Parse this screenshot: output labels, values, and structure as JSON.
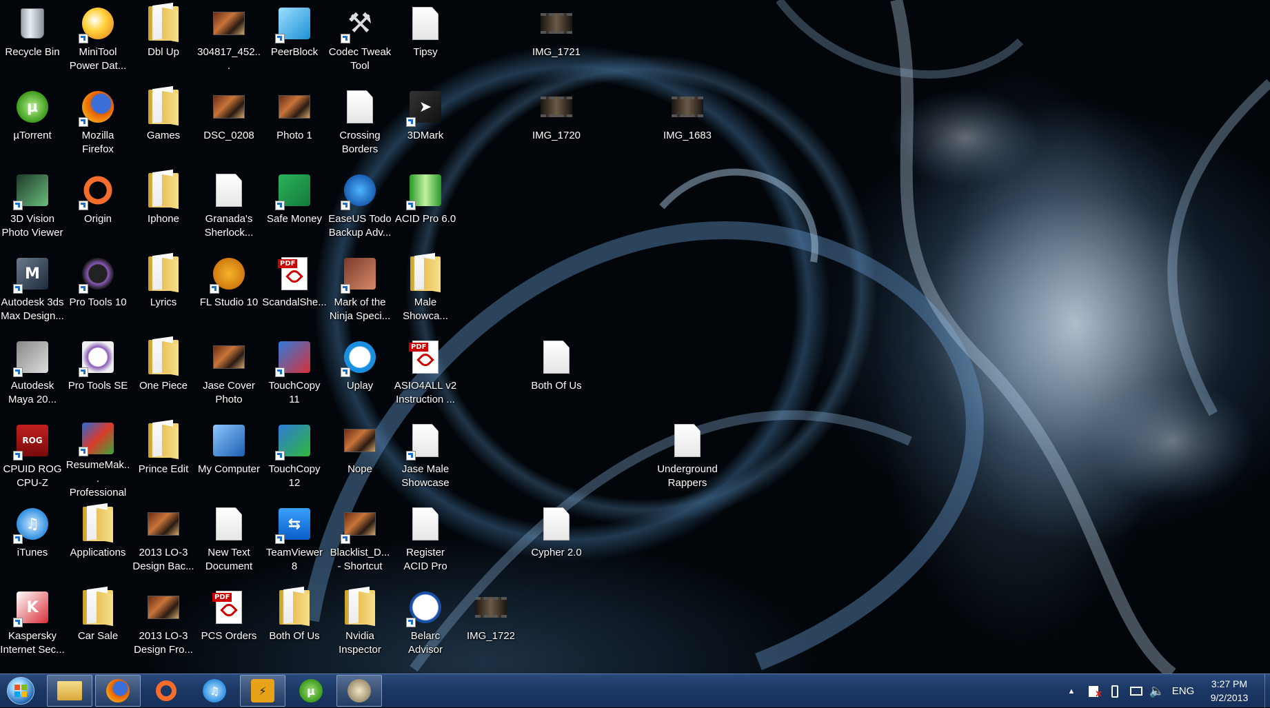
{
  "desktop": {
    "icons": [
      "Recycle Bin",
      "MiniTool\nPower Dat...",
      "Dbl Up",
      "304817_452...",
      "PeerBlock",
      "Codec Tweak\nTool",
      "Tipsy",
      "µTorrent",
      "Mozilla\nFirefox",
      "Games",
      "DSC_0208",
      "Photo 1",
      "Crossing\nBorders",
      "3DMark",
      "3D Vision\nPhoto Viewer",
      "Origin",
      "Iphone",
      "Granada's\nSherlock...",
      "Safe Money",
      "EaseUS Todo\nBackup Adv...",
      "ACID Pro 6.0",
      "Autodesk 3ds\nMax Design...",
      "Pro Tools 10",
      "Lyrics",
      "FL Studio 10",
      "ScandalShe...",
      "Mark of the\nNinja Speci...",
      "Male\nShowca...",
      "Autodesk\nMaya 20...",
      "Pro Tools SE",
      "One Piece",
      "Jase Cover\nPhoto",
      "TouchCopy\n11",
      "Uplay",
      "ASIO4ALL v2\nInstruction ...",
      "CPUID ROG\nCPU-Z",
      "ResumeMak...\nProfessional",
      "Prince Edit",
      "My Computer",
      "TouchCopy\n12",
      "Nope",
      "Jase Male\nShowcase",
      "iTunes",
      "Applications",
      "2013 LO-3\nDesign Bac...",
      "New Text\nDocument",
      "TeamViewer\n8",
      "Blacklist_D...\n- Shortcut",
      "Register\nACID Pro",
      "Kaspersky\nInternet Sec...",
      "Car Sale",
      "2013 LO-3\nDesign Fro...",
      "PCS Orders",
      "Both Of Us",
      "Nvidia\nInspector",
      "Belarc\nAdvisor",
      "IMG_1722",
      "IMG_1721",
      "IMG_1720",
      "IMG_1683",
      "Both Of Us",
      "Underground\nRappers",
      "Cypher 2.0"
    ]
  },
  "taskbar": {
    "clock_time": "3:27 PM",
    "clock_date": "9/2/2013",
    "language": "ENG",
    "tray_up_arrow": "▲"
  }
}
